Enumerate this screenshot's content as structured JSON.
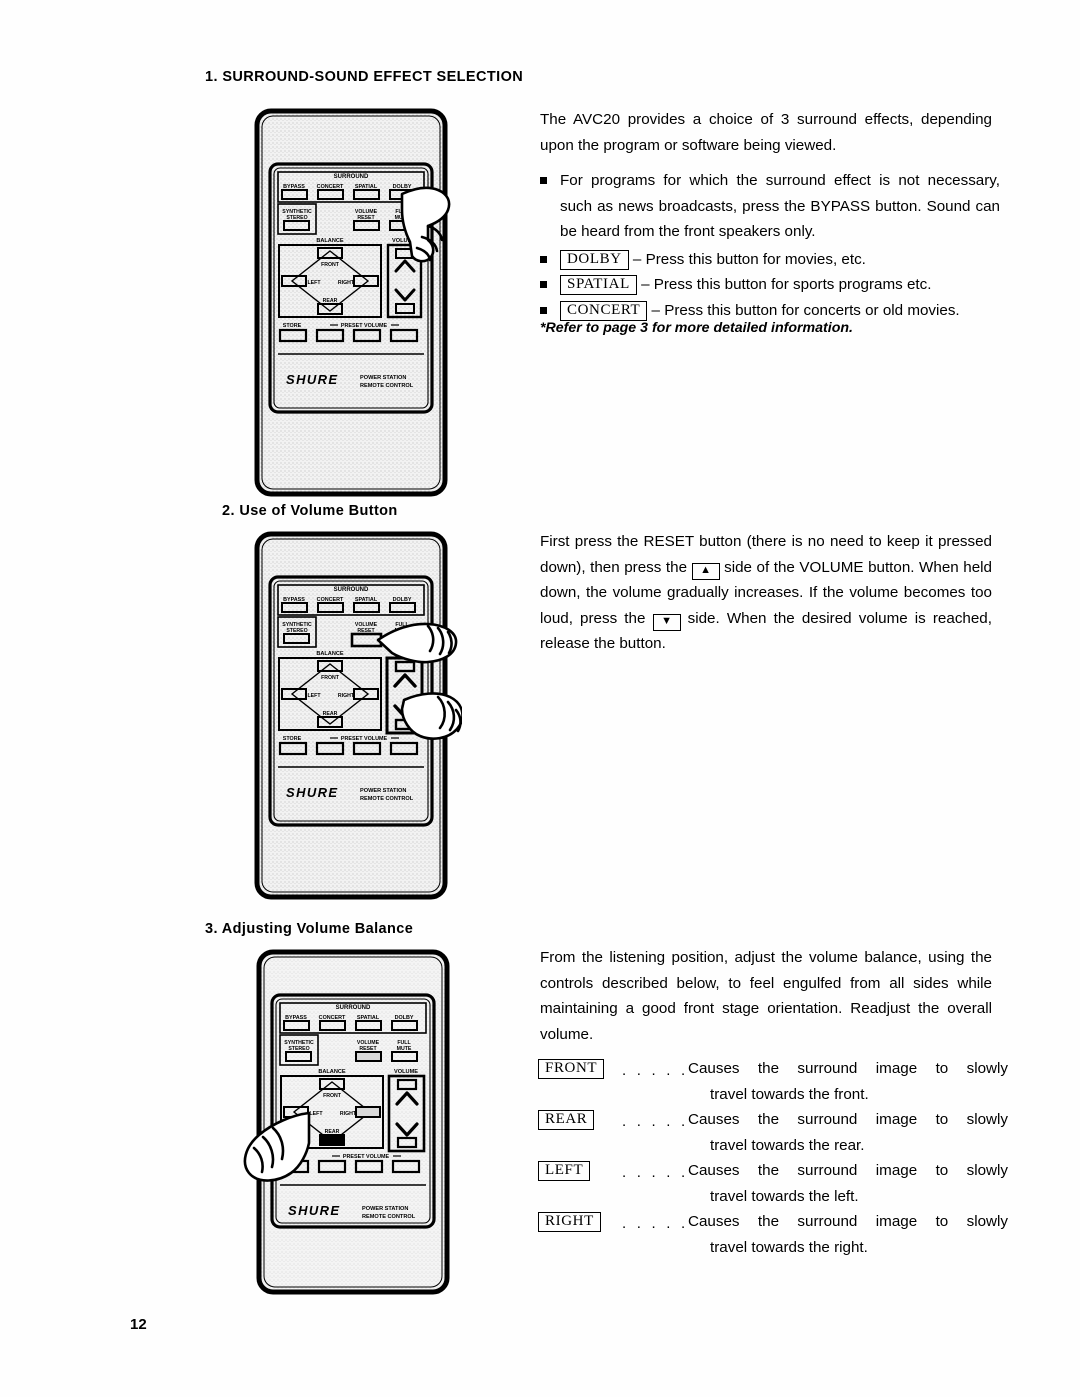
{
  "page": {
    "number": "12"
  },
  "sections": [
    {
      "heading": "1.  SURROUND-SOUND EFFECT SELECTION",
      "intro": "The AVC20 provides a choice of 3 surround effects, depending upon the program or software being viewed.",
      "bullets": [
        {
          "text": "For programs for which the surround effect is not nece­ssary, such as news broadcasts, press the BYPASS but­ton. Sound can be heard from the front speakers only."
        },
        {
          "key": "DOLBY",
          "text": "– Press this button for movies, etc."
        },
        {
          "key": "SPATIAL",
          "text": "– Press this button for sports programs etc."
        },
        {
          "key": "CONCERT",
          "text": "– Press this button for concerts or old movies."
        }
      ],
      "note": "*Refer to page 3 for more detailed information."
    },
    {
      "heading": "2.  Use of Volume Button",
      "paragraph_1": "First press the RESET button (there is no need to keep it pressed down), then press the",
      "paragraph_2": "side of the  VOLUME button. When held down, the volume gradually increases. If the volume becomes too loud, press the",
      "paragraph_3": "side. When the desired volume is reached, release the button.",
      "arrow_up": "▲",
      "arrow_down": "▼"
    },
    {
      "heading": "3.  Adjusting Volume Balance",
      "intro": "From the listening position, adjust the volume balance, using the controls described below, to feel engulfed from all sides while maintaining a good front stage orientation. Readjust the overall volume.",
      "dots": ". . . . . . .",
      "definitions": [
        {
          "key": "FRONT",
          "line1": "Causes the surround image to slowly",
          "line2": "travel towards the front."
        },
        {
          "key": "REAR",
          "line1": "Causes the surround image to slowly",
          "line2": "travel towards the rear."
        },
        {
          "key": "LEFT",
          "line1": "Causes the surround image to slowly",
          "line2": "travel towards the left."
        },
        {
          "key": "RIGHT",
          "line1": "Causes the surround image to slowly",
          "line2": "travel towards the right."
        }
      ]
    }
  ],
  "remote": {
    "brand": "SHURE",
    "brand_sub_line1": "POWER STATION",
    "brand_sub_line2": "REMOTE CONTROL",
    "group_surround": "SURROUND",
    "group_balance": "BALANCE",
    "group_volume": "VOLUME",
    "group_preset": "PRESET VOLUME",
    "buttons": {
      "bypass": "BYPASS",
      "concert": "CONCERT",
      "spatial": "SPATIAL",
      "dolby": "DOLBY",
      "synthetic": "SYNTHETIC",
      "stereo": "STEREO",
      "volume": "VOLUME",
      "reset": "RESET",
      "full": "FULL",
      "mute": "MUTE",
      "front": "FRONT",
      "rear": "REAR",
      "left": "LEFT",
      "right": "RIGHT",
      "store": "STORE"
    }
  },
  "colors": {
    "ink": "#000000",
    "paper": "#ffffff",
    "shade": "#e8e8e8"
  }
}
